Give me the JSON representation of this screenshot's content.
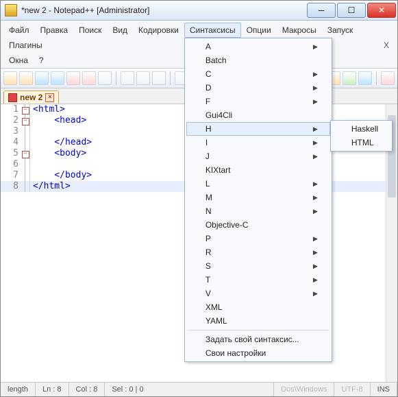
{
  "title": "*new 2 - Notepad++ [Administrator]",
  "menus": {
    "file": "Файл",
    "edit": "Правка",
    "search": "Поиск",
    "view": "Вид",
    "encoding": "Кодировки",
    "syntax": "Синтаксисы",
    "options": "Опции",
    "macros": "Макросы",
    "run": "Запуск",
    "plugins": "Плагины",
    "windows": "Окна",
    "help": "?"
  },
  "close_x": "X",
  "tab": {
    "name": "new 2",
    "close": "×"
  },
  "code": {
    "l1": "<html>",
    "l2": "    <head>",
    "l3": " ",
    "l4": "    </head>",
    "l5": "    <body>",
    "l6": " ",
    "l7": "    </body>",
    "l8": "</html>"
  },
  "syntax_menu": {
    "items": [
      {
        "label": "A",
        "sub": true
      },
      {
        "label": "Batch"
      },
      {
        "label": "C",
        "sub": true
      },
      {
        "label": "D",
        "sub": true
      },
      {
        "label": "F",
        "sub": true
      },
      {
        "label": "Gui4Cli"
      },
      {
        "label": "H",
        "sub": true,
        "hl": true
      },
      {
        "label": "I",
        "sub": true
      },
      {
        "label": "J",
        "sub": true
      },
      {
        "label": "KIXtart"
      },
      {
        "label": "L",
        "sub": true
      },
      {
        "label": "M",
        "sub": true
      },
      {
        "label": "N",
        "sub": true
      },
      {
        "label": "Objective-C"
      },
      {
        "label": "P",
        "sub": true
      },
      {
        "label": "R",
        "sub": true
      },
      {
        "label": "S",
        "sub": true
      },
      {
        "label": "T",
        "sub": true
      },
      {
        "label": "V",
        "sub": true
      },
      {
        "label": "XML"
      },
      {
        "label": "YAML"
      }
    ],
    "custom": "Задать свой синтаксис...",
    "own": "Свои настройки"
  },
  "h_submenu": {
    "haskell": "Haskell",
    "html": "HTML"
  },
  "status": {
    "length": "length",
    "ln": "Ln : 8",
    "col": "Col : 8",
    "sel": "Sel : 0 | 0",
    "dos": "Dos\\Windows",
    "enc": "UTF-8",
    "ins": "INS"
  },
  "linenums": {
    "1": "1",
    "2": "2",
    "3": "3",
    "4": "4",
    "5": "5",
    "6": "6",
    "7": "7",
    "8": "8"
  }
}
